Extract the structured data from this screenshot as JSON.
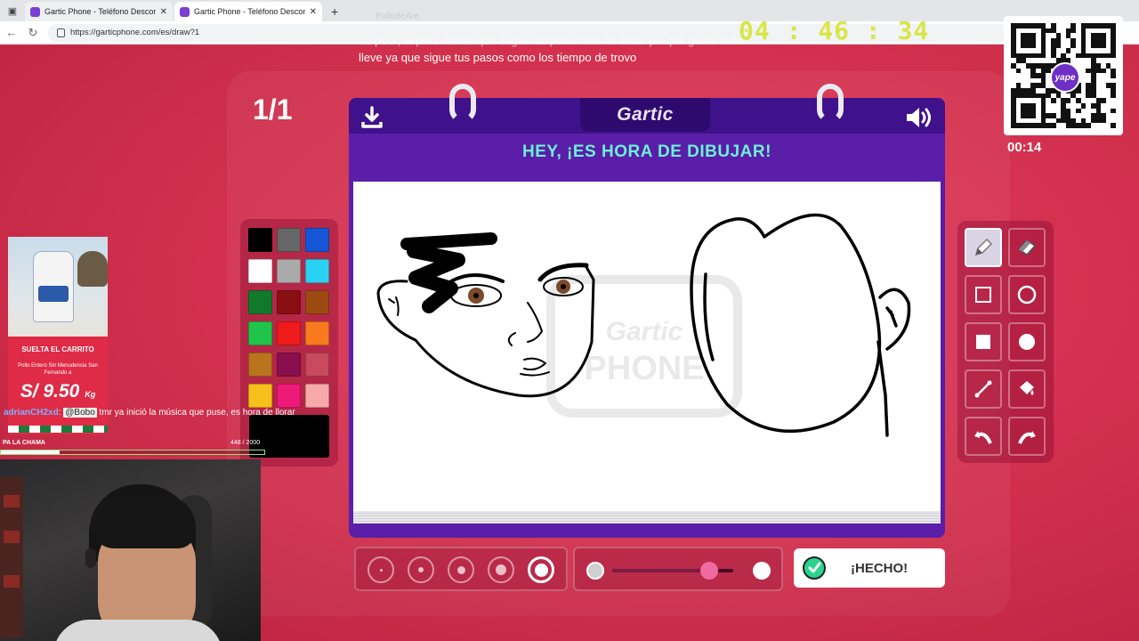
{
  "browser": {
    "tabs": [
      {
        "title": "Gartic Phone - Teléfono Descompuesto",
        "active": false
      },
      {
        "title": "Gartic Phone - Teléfono Descompuesto",
        "active": true
      }
    ],
    "new_tab": "+",
    "url": "https://garticphone.com/es/draw?1"
  },
  "overlay": {
    "stream_title": "PollodeAre",
    "lyrics_line1": "Lo peor, espera llamar que llegue un poco más de tratar pa que guste todo",
    "lyrics_line2": "lleve ya que sigue tus pasos como los tiempo de trovo",
    "timer": "04 : 46 : 34",
    "qr_badge": "yape",
    "qr_timer": "00:14"
  },
  "game": {
    "round_counter": "1/1",
    "logo": "Gartic",
    "title": "HEY, ¡ES HORA DE DIBUJAR!",
    "watermark": "Gartic PHONE",
    "done_label": "¡HECHO!",
    "colors": [
      "#000000",
      "#666666",
      "#1456d6",
      "#ffffff",
      "#aaaaaa",
      "#29d2f2",
      "#117a2a",
      "#8a0f12",
      "#9c4a12",
      "#21c44a",
      "#ef1a1a",
      "#f97a1d",
      "#b9741d",
      "#8a0f4e",
      "#c94a5c",
      "#f7bf19",
      "#ed1a7a",
      "#f7a9a9"
    ],
    "current_color": "#000000",
    "tools": [
      "pencil-icon",
      "eraser-icon",
      "rectangle-outline-icon",
      "circle-outline-icon",
      "rectangle-filled-icon",
      "circle-filled-icon",
      "line-icon",
      "fill-bucket-icon",
      "undo-icon",
      "redo-icon"
    ],
    "active_tool": "pencil-icon",
    "brush_sizes": 5,
    "selected_brush_size": 5,
    "opacity_level": 0.8
  },
  "stream": {
    "ad_title": "SUELTA EL CARRITO",
    "ad_subtitle": "Pollo Entero Sin Menudencia San Fernando a",
    "ad_price": "S/ 9.50",
    "ad_unit": "Kg",
    "chat_user": "adrianCH2xd",
    "chat_mention": "@Bobo",
    "chat_text": "tmr ya inició la música que puse, es hora de llorar",
    "goal_label": "PA LA CHAMA",
    "goal_count": "448 / 2000",
    "goal_current": 448,
    "goal_total": 2000
  }
}
